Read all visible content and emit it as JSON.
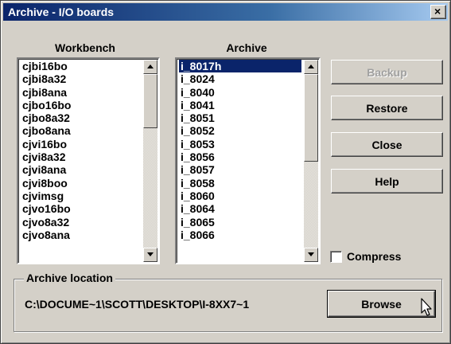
{
  "window": {
    "title": "Archive - I/O boards",
    "close_glyph": "×"
  },
  "workbench": {
    "heading": "Workbench",
    "items": [
      "cjbi16bo",
      "cjbi8a32",
      "cjbi8ana",
      "cjbo16bo",
      "cjbo8a32",
      "cjbo8ana",
      "cjvi16bo",
      "cjvi8a32",
      "cjvi8ana",
      "cjvi8boo",
      "cjvimsg",
      "cjvo16bo",
      "cjvo8a32",
      "cjvo8ana"
    ]
  },
  "archive": {
    "heading": "Archive",
    "selected": "i_8017h",
    "items": [
      "i_8017h",
      "i_8024",
      "i_8040",
      "i_8041",
      "i_8051",
      "i_8052",
      "i_8053",
      "i_8056",
      "i_8057",
      "i_8058",
      "i_8060",
      "i_8064",
      "i_8065",
      "i_8066"
    ]
  },
  "buttons": {
    "backup": "Backup",
    "restore": "Restore",
    "close": "Close",
    "help": "Help",
    "browse": "Browse"
  },
  "compress": {
    "label": "Compress",
    "checked": false
  },
  "location": {
    "group_label": "Archive location",
    "path": "C:\\DOCUME~1\\SCOTT\\DESKTOP\\I-8XX7~1"
  },
  "icons": {
    "close": "close-icon",
    "scroll_up": "scroll-up-arrow-icon",
    "scroll_down": "scroll-down-arrow-icon",
    "cursor": "mouse-pointer-icon"
  },
  "colors": {
    "title_bar_start": "#0a246a",
    "title_bar_end": "#a6caf0",
    "dialog_face": "#d4d0c8",
    "selection": "#0a246a"
  }
}
